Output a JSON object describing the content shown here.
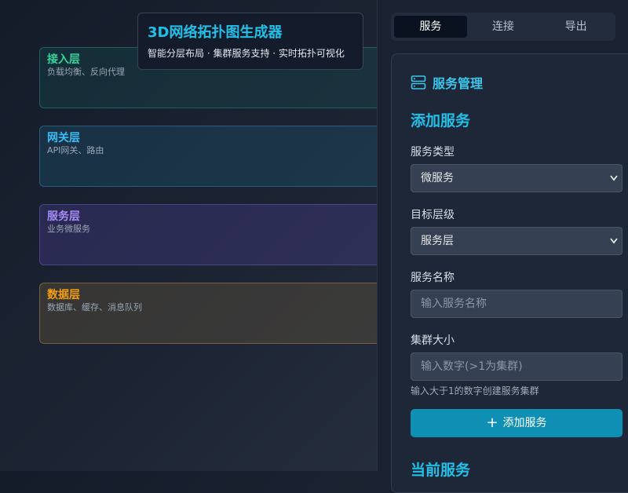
{
  "header": {
    "title": "3D网络拓扑图生成器",
    "subtitle": "智能分层布局 · 集群服务支持 · 实时拓扑可视化"
  },
  "layers": [
    {
      "title": "接入层",
      "desc": "负载均衡、反向代理",
      "color": "#34d399"
    },
    {
      "title": "网关层",
      "desc": "API网关、路由",
      "color": "#38bdf8"
    },
    {
      "title": "服务层",
      "desc": "业务微服务",
      "color": "#a78bfa"
    },
    {
      "title": "数据层",
      "desc": "数据库、缓存、消息队列",
      "color": "#f59e0b"
    }
  ],
  "tabs": [
    {
      "label": "服务",
      "active": true
    },
    {
      "label": "连接",
      "active": false
    },
    {
      "label": "导出",
      "active": false
    }
  ],
  "panel": {
    "title": "服务管理",
    "icon": "server-icon",
    "add_section_title": "添加服务",
    "service_type": {
      "label": "服务类型",
      "value": "微服务"
    },
    "target_layer": {
      "label": "目标层级",
      "value": "服务层"
    },
    "service_name": {
      "label": "服务名称",
      "placeholder": "输入服务名称"
    },
    "cluster_size": {
      "label": "集群大小",
      "placeholder": "输入数字(>1为集群)",
      "hint": "输入大于1的数字创建服务集群"
    },
    "add_button": "添加服务",
    "current_section_title": "当前服务"
  },
  "colors": {
    "accent": "#22c0e8",
    "button": "#0e8fb3"
  }
}
